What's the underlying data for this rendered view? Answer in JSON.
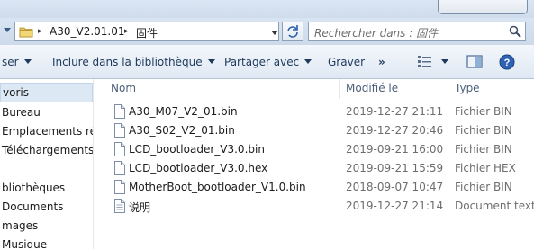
{
  "address": {
    "segments": [
      "A30_V2.01.01",
      "固件"
    ],
    "separator": "▸"
  },
  "search": {
    "placeholder": "Rechercher dans : 固件"
  },
  "toolbar": {
    "organize": "ser",
    "include_library": "Inclure dans la bibliothèque",
    "share_with": "Partager avec",
    "burn": "Graver",
    "more": "»"
  },
  "sidebar": {
    "items": [
      {
        "label": "voris"
      },
      {
        "label": "Bureau"
      },
      {
        "label": "Emplacements récen"
      },
      {
        "label": "Téléchargements"
      },
      {
        "label": "bliothèques"
      },
      {
        "label": "Documents"
      },
      {
        "label": "mages"
      },
      {
        "label": "Musique"
      }
    ]
  },
  "columns": {
    "name": "Nom",
    "modified": "Modifié le",
    "type": "Type"
  },
  "files": [
    {
      "name": "A30_M07_V2_01.bin",
      "modified": "2019-12-27 21:11",
      "type": "Fichier BIN",
      "icon": "file-icon"
    },
    {
      "name": "A30_S02_V2_01.bin",
      "modified": "2019-12-27 20:46",
      "type": "Fichier BIN",
      "icon": "file-icon"
    },
    {
      "name": "LCD_bootloader_V3.0.bin",
      "modified": "2019-09-21 16:00",
      "type": "Fichier BIN",
      "icon": "file-icon"
    },
    {
      "name": "LCD_bootloader_V3.0.hex",
      "modified": "2019-09-21 15:59",
      "type": "Fichier HEX",
      "icon": "file-icon"
    },
    {
      "name": "MotherBoot_bootloader_V1.0.bin",
      "modified": "2018-09-07 10:47",
      "type": "Fichier BIN",
      "icon": "file-icon"
    },
    {
      "name": "说明",
      "modified": "2019-12-27 21:14",
      "type": "Document texte",
      "icon": "text-document-icon"
    }
  ],
  "colors": {
    "toolbar_text": "#1e395b",
    "accent": "#2a5db0"
  }
}
